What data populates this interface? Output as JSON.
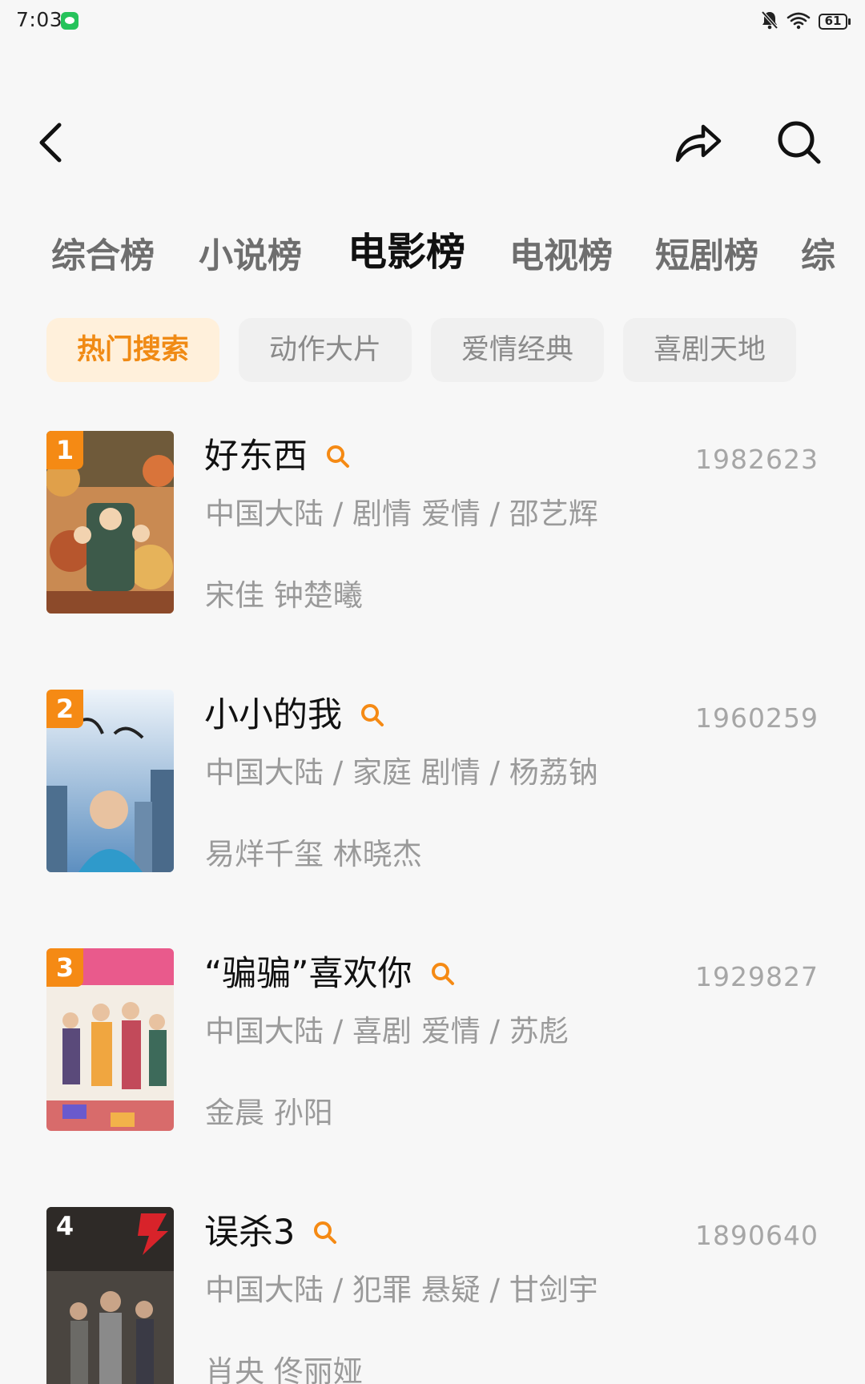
{
  "status_bar": {
    "time": "7:03",
    "battery": "61"
  },
  "rank_tabs": [
    "综合榜",
    "小说榜",
    "电影榜",
    "电视榜",
    "短剧榜",
    "综"
  ],
  "category_chips": [
    "热门搜索",
    "动作大片",
    "爱情经典",
    "喜剧天地"
  ],
  "movies": [
    {
      "rank": "1",
      "title": "好东西",
      "count": "1982623",
      "meta": "中国大陆 / 剧情 爱情 / 邵艺辉",
      "cast": "宋佳 钟楚曦"
    },
    {
      "rank": "2",
      "title": "小小的我",
      "count": "1960259",
      "meta": "中国大陆 / 家庭 剧情 / 杨荔钠",
      "cast": "易烊千玺 林晓杰"
    },
    {
      "rank": "3",
      "title": "“骗骗”喜欢你",
      "count": "1929827",
      "meta": "中国大陆 / 喜剧 爱情 / 苏彪",
      "cast": "金晨 孙阳"
    },
    {
      "rank": "4",
      "title": "误杀3",
      "count": "1890640",
      "meta": "中国大陆 / 犯罪 悬疑 / 甘剑宇",
      "cast": "肖央 佟丽娅"
    }
  ],
  "colors": {
    "accent": "#f58a14",
    "chip_active_bg": "#fff0db",
    "background": "#f7f7f7"
  },
  "icons": {
    "back": "chevron-left-icon",
    "share": "share-arrow-icon",
    "search": "search-icon",
    "item_search": "small-search-icon"
  }
}
